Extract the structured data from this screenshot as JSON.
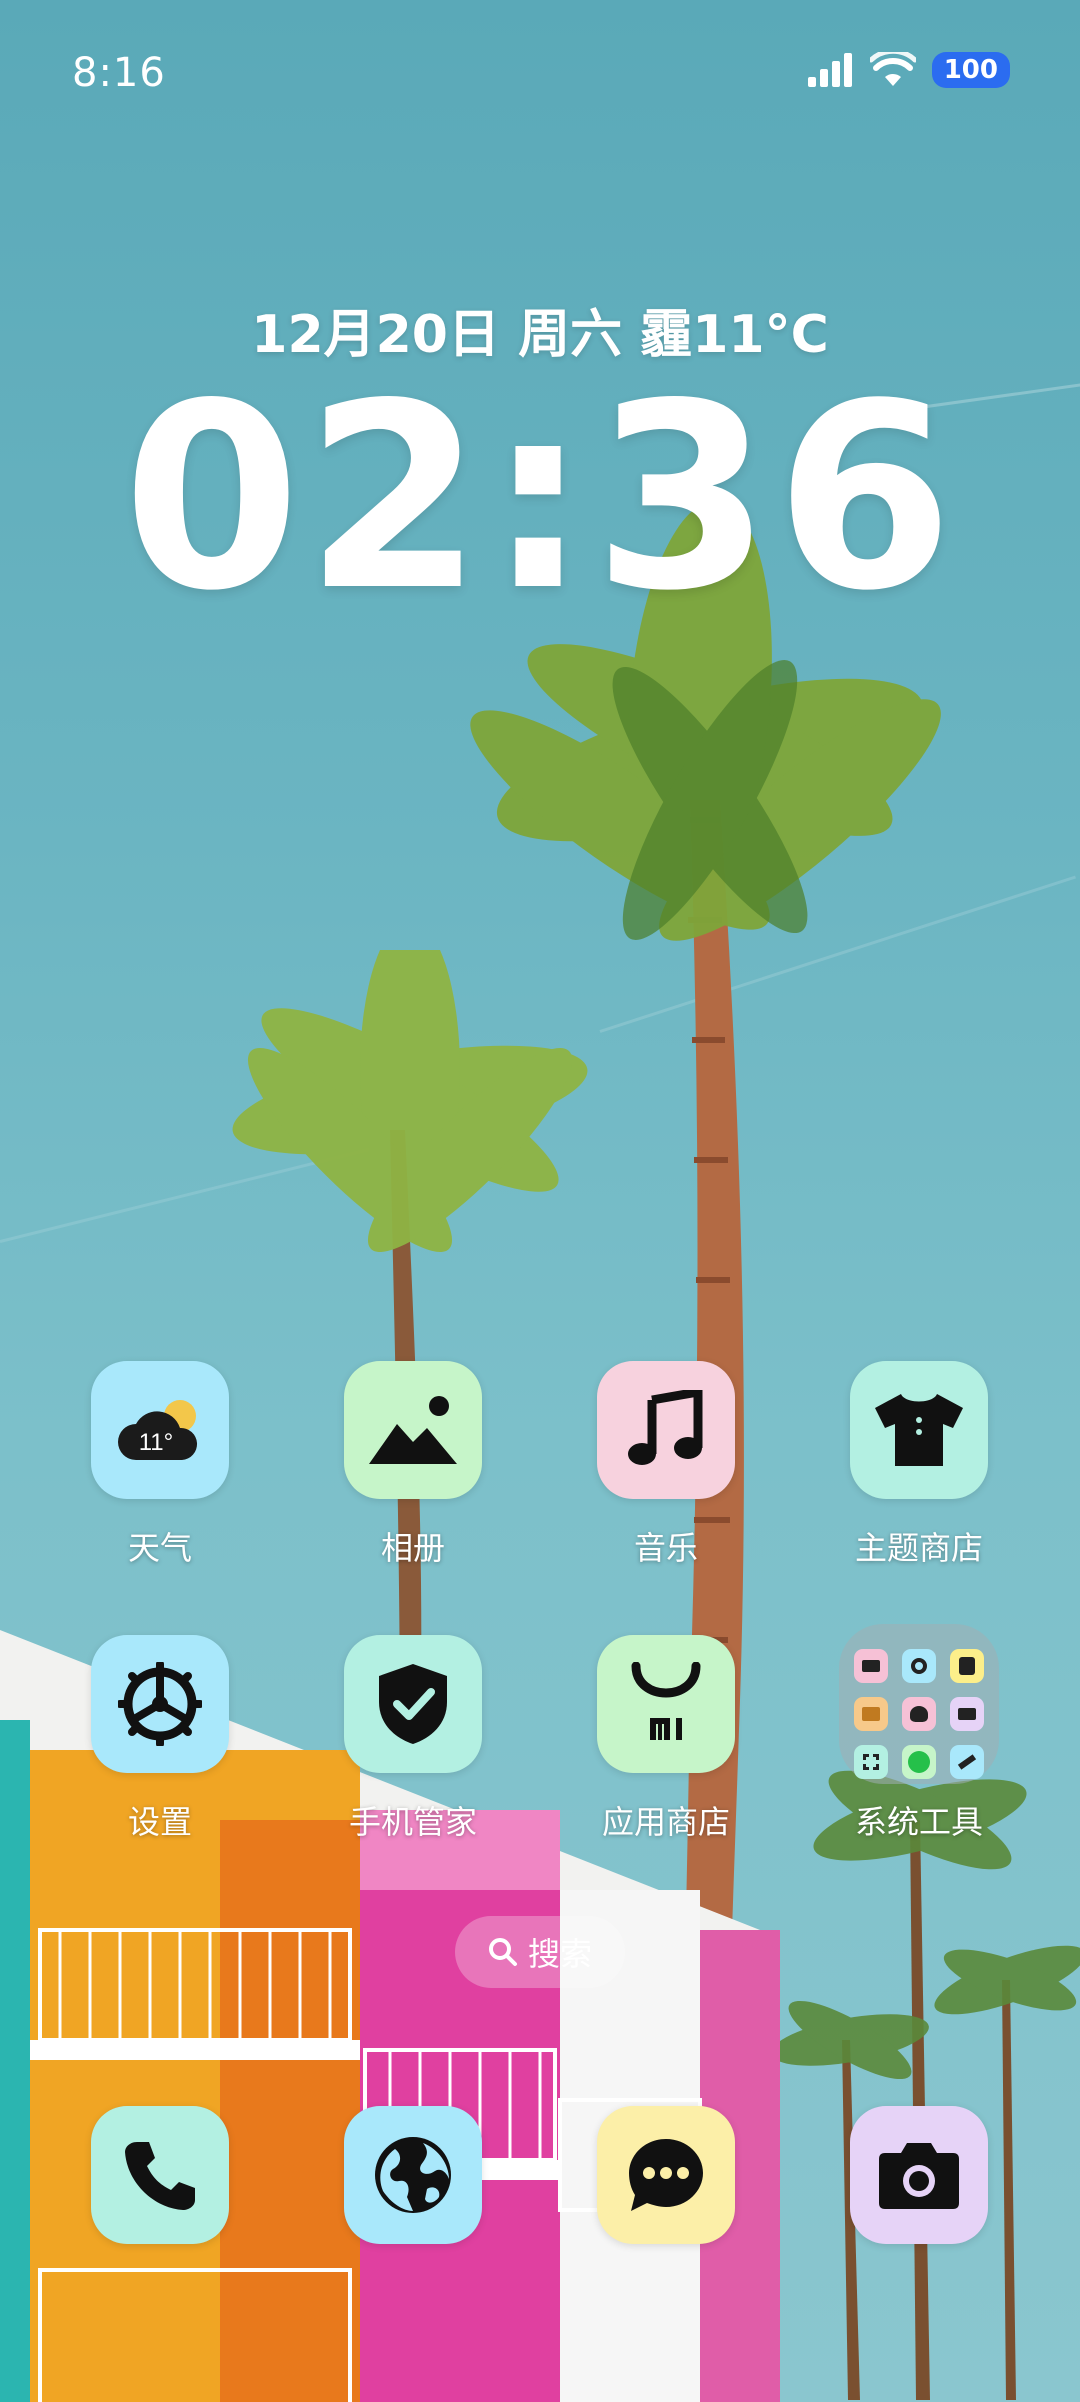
{
  "status_bar": {
    "time": "8:16",
    "battery": "100"
  },
  "clock_widget": {
    "date": "12月20日 周六 霾11°C",
    "time": "02:36"
  },
  "weather_icon_temp": "11°",
  "apps_row1": [
    {
      "label": "天气",
      "icon": "weather-icon",
      "bg": "#a9e8fb"
    },
    {
      "label": "相册",
      "icon": "gallery-icon",
      "bg": "#c6f5c9"
    },
    {
      "label": "音乐",
      "icon": "music-icon",
      "bg": "#f7d2de"
    },
    {
      "label": "主题商店",
      "icon": "theme-icon",
      "bg": "#b3f0e2"
    }
  ],
  "apps_row2": [
    {
      "label": "设置",
      "icon": "settings-icon",
      "bg": "#a9e8fb"
    },
    {
      "label": "手机管家",
      "icon": "security-icon",
      "bg": "#b3f0e2"
    },
    {
      "label": "应用商店",
      "icon": "app-store-icon",
      "bg": "#c6f5c9"
    },
    {
      "label": "系统工具",
      "icon": "folder-icon",
      "bg": "#a0afb4"
    }
  ],
  "search": {
    "label": "搜索"
  },
  "dock": [
    {
      "icon": "phone-icon",
      "bg": "#b3f0e2"
    },
    {
      "icon": "browser-icon",
      "bg": "#a9e8fb"
    },
    {
      "icon": "messages-icon",
      "bg": "#fcefa8"
    },
    {
      "icon": "camera-icon",
      "bg": "#e6d3f7"
    }
  ]
}
